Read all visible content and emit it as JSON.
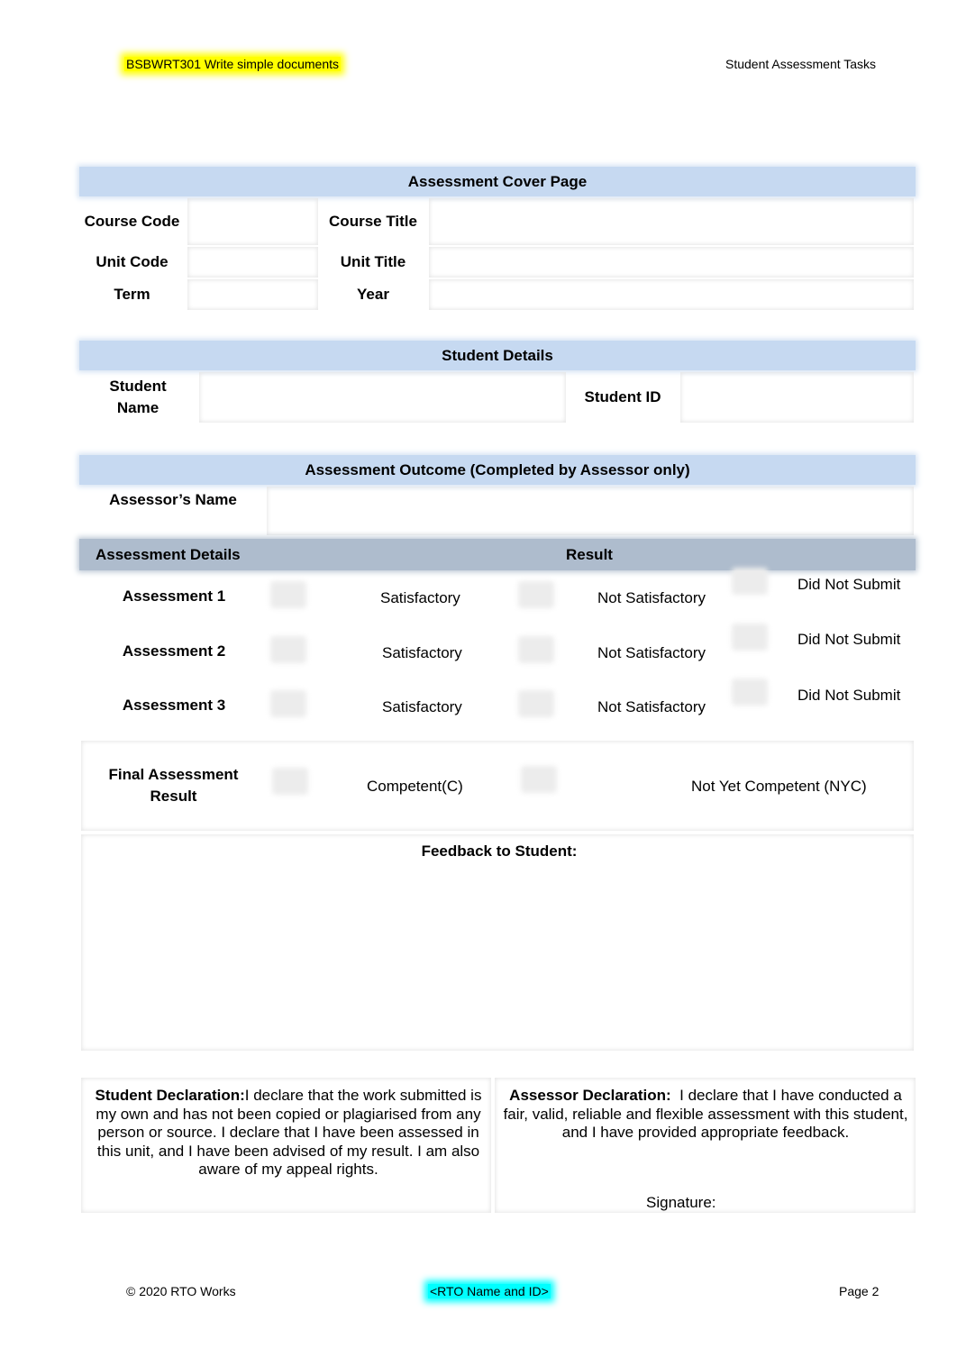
{
  "header": {
    "unit": "BSBWRT301 Write simple documents",
    "doc_title": "Student Assessment Tasks"
  },
  "cover": {
    "title": "Assessment Cover Page",
    "course_code": "Course Code",
    "course_title": "Course Title",
    "unit_code": "Unit Code",
    "unit_title": "Unit Title",
    "term": "Term",
    "year": "Year"
  },
  "student": {
    "title": "Student Details",
    "name_label": "Student Name",
    "id_label": "Student ID"
  },
  "outcome": {
    "title": "Assessment Outcome (Completed by Assessor only)",
    "assessor_name": "Assessor’s Name",
    "details_header": "Assessment Details",
    "result_header": "Result",
    "rows": [
      {
        "label": "Assessment 1",
        "sat": "Satisfactory",
        "not_sat": "Not Satisfactory",
        "dns": "Did Not Submit"
      },
      {
        "label": "Assessment 2",
        "sat": "Satisfactory",
        "not_sat": "Not Satisfactory",
        "dns": "Did Not Submit"
      },
      {
        "label": "Assessment 3",
        "sat": "Satisfactory",
        "not_sat": "Not Satisfactory",
        "dns": "Did Not Submit"
      }
    ],
    "final_label": "Final Assessment Result",
    "competent": "Competent(C)",
    "nyc": "Not Yet Competent (NYC)",
    "feedback": "Feedback to Student:"
  },
  "declarations": {
    "student_bold": "Student Declaration:",
    "student_text": "I declare that the work submitted is my own and has not been copied or plagiarised from any person or source. I declare that I have been assessed in this unit, and I have been advised of my result.  I am also aware of my appeal rights.",
    "assessor_bold": "Assessor Declaration:",
    "assessor_text": "  I declare that I have conducted a fair, valid, reliable and flexible assessment with this student, and I have provided appropriate feedback.",
    "signature": "Signature:"
  },
  "footer": {
    "copyright": "© 2020 RTO Works",
    "rto": "<RTO Name and ID>",
    "page": "Page 2"
  }
}
